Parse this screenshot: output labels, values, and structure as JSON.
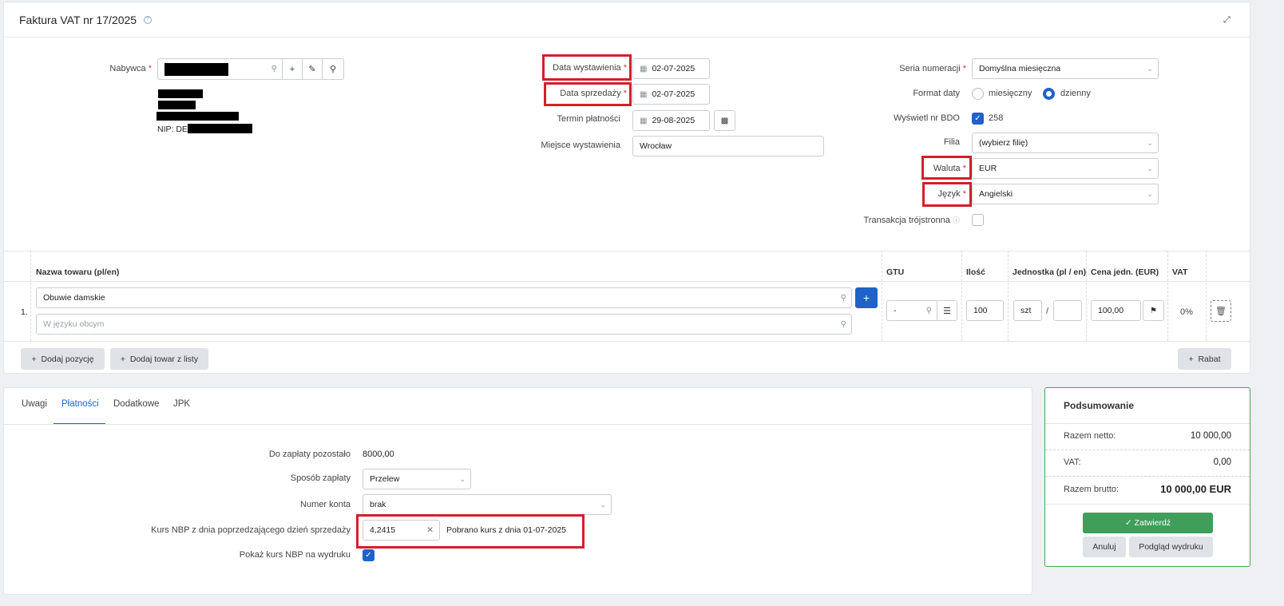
{
  "header": {
    "title": "Faktura VAT nr 17/2025"
  },
  "buyer": {
    "label": "Nabywca",
    "nip_prefix": "NIP: DE"
  },
  "dates": {
    "issue_label": "Data wystawienia",
    "issue_value": "02-07-2025",
    "sale_label": "Data sprzedaży",
    "sale_value": "02-07-2025",
    "due_label": "Termin płatności",
    "due_value": "29-08-2025",
    "place_label": "Miejsce wystawienia",
    "place_value": "Wrocław"
  },
  "right": {
    "series_label": "Seria numeracji",
    "series_value": "Domyślna miesięczna",
    "dateformat_label": "Format daty",
    "opt_monthly": "miesięczny",
    "opt_daily": "dzienny",
    "bdo_label": "Wyświetl nr BDO",
    "bdo_value": "258",
    "branch_label": "Filia",
    "branch_value": "(wybierz filię)",
    "currency_label": "Waluta",
    "currency_value": "EUR",
    "language_label": "Język",
    "language_value": "Angielski",
    "triangular_label": "Transakcja trójstronna"
  },
  "table": {
    "headers": [
      "Nazwa towaru (pl/en)",
      "GTU",
      "Ilość",
      "Jednostka (pl / en)",
      "Cena jedn. (EUR)",
      "VAT"
    ],
    "row": {
      "index": "1.",
      "name": "Obuwie damskie",
      "foreign_placeholder": "W języku obcym",
      "gtu": "-",
      "qty": "100",
      "unit": "szt",
      "unit_sep": "/",
      "price": "100,00",
      "vat": "0%"
    },
    "add_position": "Dodaj pozycję",
    "add_from_list": "Dodaj towar z listy",
    "discount": "Rabat"
  },
  "tabs": [
    "Uwagi",
    "Płatności",
    "Dodatkowe",
    "JPK"
  ],
  "payment": {
    "remaining_label": "Do zapłaty pozostało",
    "remaining_value": "8000,00",
    "method_label": "Sposób zapłaty",
    "method_value": "Przelew",
    "account_label": "Numer konta",
    "account_value": "brak",
    "rate_label": "Kurs NBP z dnia poprzedzającego dzień sprzedaży",
    "rate_value": "4,2415",
    "rate_info": "Pobrano kurs z dnia 01-07-2025",
    "show_rate_label": "Pokaż kurs NBP na wydruku"
  },
  "summary": {
    "title": "Podsumowanie",
    "net_label": "Razem netto:",
    "net_value": "10 000,00",
    "vat_label": "VAT:",
    "vat_value": "0,00",
    "gross_label": "Razem brutto:",
    "gross_value": "10 000,00 EUR",
    "confirm": "Zatwierdź",
    "cancel": "Anuluj",
    "preview": "Podgląd wydruku"
  }
}
